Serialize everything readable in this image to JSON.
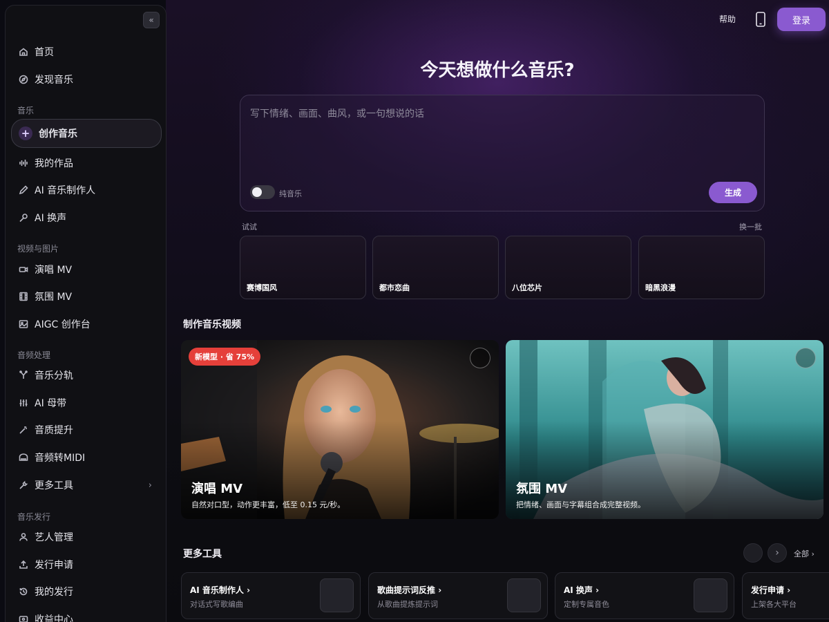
{
  "sidebar": {
    "items": [
      {
        "label": "首页",
        "icon": "home-icon"
      },
      {
        "label": "发现音乐",
        "icon": "compass-icon"
      },
      {
        "label": "创作音乐",
        "icon": "plus-icon",
        "active": true
      },
      {
        "label": "我的作品",
        "icon": "waveform-icon"
      },
      {
        "label": "AI 音乐制作人",
        "icon": "pen-icon"
      },
      {
        "label": "AI 换声",
        "icon": "microphone-icon"
      },
      {
        "label": "演唱 MV",
        "icon": "video-icon"
      },
      {
        "label": "氛围 MV",
        "icon": "film-icon"
      },
      {
        "label": "AIGC 创作台",
        "icon": "image-icon"
      },
      {
        "label": "音乐分轨",
        "icon": "split-icon"
      },
      {
        "label": "AI 母带",
        "icon": "sliders-icon"
      },
      {
        "label": "音质提升",
        "icon": "magic-wand-icon"
      },
      {
        "label": "音频转MIDI",
        "icon": "piano-icon"
      },
      {
        "label": "更多工具",
        "icon": "wrench-icon"
      },
      {
        "label": "艺人管理",
        "icon": "user-icon"
      },
      {
        "label": "发行申请",
        "icon": "upload-icon"
      },
      {
        "label": "我的发行",
        "icon": "history-icon"
      },
      {
        "label": "收益中心",
        "icon": "wallet-icon"
      }
    ],
    "sections": [
      "音乐",
      "视频与图片",
      "音频处理",
      "音乐发行"
    ]
  },
  "header": {
    "help": "帮助",
    "login": "登录"
  },
  "hero": {
    "title": "今天想做什么音乐?",
    "placeholder": "写下情绪、画面、曲风，或一句想说的话",
    "toggle_label": "纯音乐",
    "generate": "生成",
    "try_label": "试试",
    "refresh": "换一批",
    "styles": [
      "赛博国风",
      "都市恋曲",
      "八位芯片",
      "暗黑浪漫"
    ]
  },
  "mv": {
    "section_title": "制作音乐视频",
    "cards": [
      {
        "title": "演唱 MV",
        "desc": "自然对口型，动作更丰富，低至 0.15 元/秒。",
        "badge": "新模型 · 省 75%"
      },
      {
        "title": "氛围 MV",
        "desc": "把情绪、画面与字幕组合成完整视频。"
      }
    ]
  },
  "tools": {
    "section_title": "更多工具",
    "all": "全部",
    "cards": [
      {
        "title": "AI 音乐制作人",
        "desc": "对话式写歌编曲"
      },
      {
        "title": "歌曲提示词反推",
        "desc": "从歌曲提炼提示词"
      },
      {
        "title": "AI 换声",
        "desc": "定制专属音色"
      },
      {
        "title": "发行申请",
        "desc": "上架各大平台"
      }
    ]
  },
  "colors": {
    "accent": "#8a5ad0",
    "badge": "#e5403a"
  }
}
